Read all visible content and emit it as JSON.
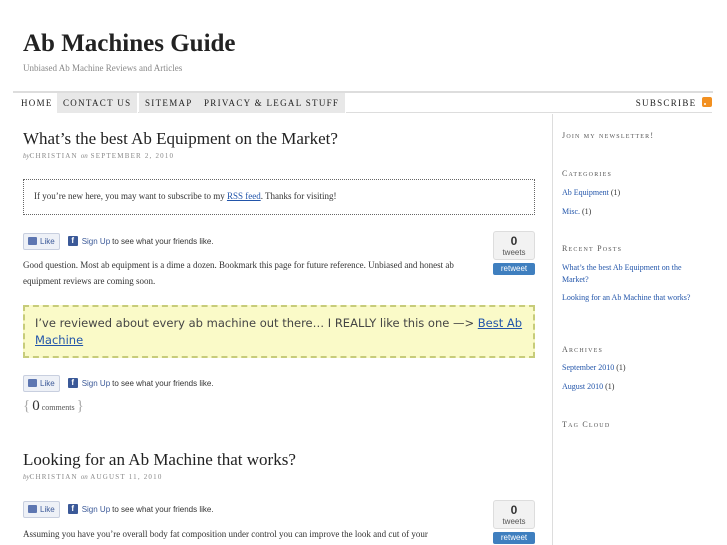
{
  "site": {
    "title": "Ab Machines Guide",
    "tagline": "Unbiased Ab Machine Reviews and Articles"
  },
  "nav": {
    "items": [
      "HOME",
      "CONTACT US",
      "SITEMAP",
      "PRIVACY & LEGAL STUFF"
    ],
    "subscribe": "SUBSCRIBE",
    "subscribe_icon": "rss-icon"
  },
  "post1": {
    "title": "What’s the best Ab Equipment on the Market?",
    "by": "by",
    "author": "CHRISTIAN",
    "on": "on",
    "date": "SEPTEMBER 2, 2010",
    "notice_before": "If you’re new here, you may want to subscribe to my ",
    "notice_link": "RSS feed",
    "notice_after": ". Thanks for visiting!",
    "body": "Good question.  Most ab equipment is a dime a dozen.  Bookmark this page for future reference.  Unbiased and honest ab equipment reviews are coming soon.",
    "callout_text": "I’ve reviewed about every ab machine out there… I REALLY like this one —> ",
    "callout_link": "Best Ab Machine",
    "comments_count": "0",
    "comments_label": "comments"
  },
  "facebook": {
    "like": "Like",
    "signup": "Sign Up",
    "rest": "to see what your friends like."
  },
  "tweet": {
    "count": "0",
    "label": "tweets",
    "retweet": "retweet"
  },
  "post2": {
    "title": "Looking for an Ab Machine that works?",
    "by": "by",
    "author": "CHRISTIAN",
    "on": "on",
    "date": "AUGUST 11, 2010",
    "body": "Assuming you have you’re overall body fat composition under control you can improve the look and cut of your"
  },
  "sidebar": {
    "newsletter": "Join my newsletter!",
    "categories_title": "Categories",
    "categories": [
      {
        "name": "Ab Equipment",
        "count": "(1)"
      },
      {
        "name": "Misc.",
        "count": "(1)"
      }
    ],
    "recent_title": "Recent Posts",
    "recent": [
      "What’s the best Ab Equipment on the Market?",
      "Looking for an Ab Machine that works?"
    ],
    "archives_title": "Archives",
    "archives": [
      {
        "name": "September 2010",
        "count": "(1)"
      },
      {
        "name": "August 2010",
        "count": "(1)"
      }
    ],
    "tagcloud_title": "Tag Cloud"
  }
}
